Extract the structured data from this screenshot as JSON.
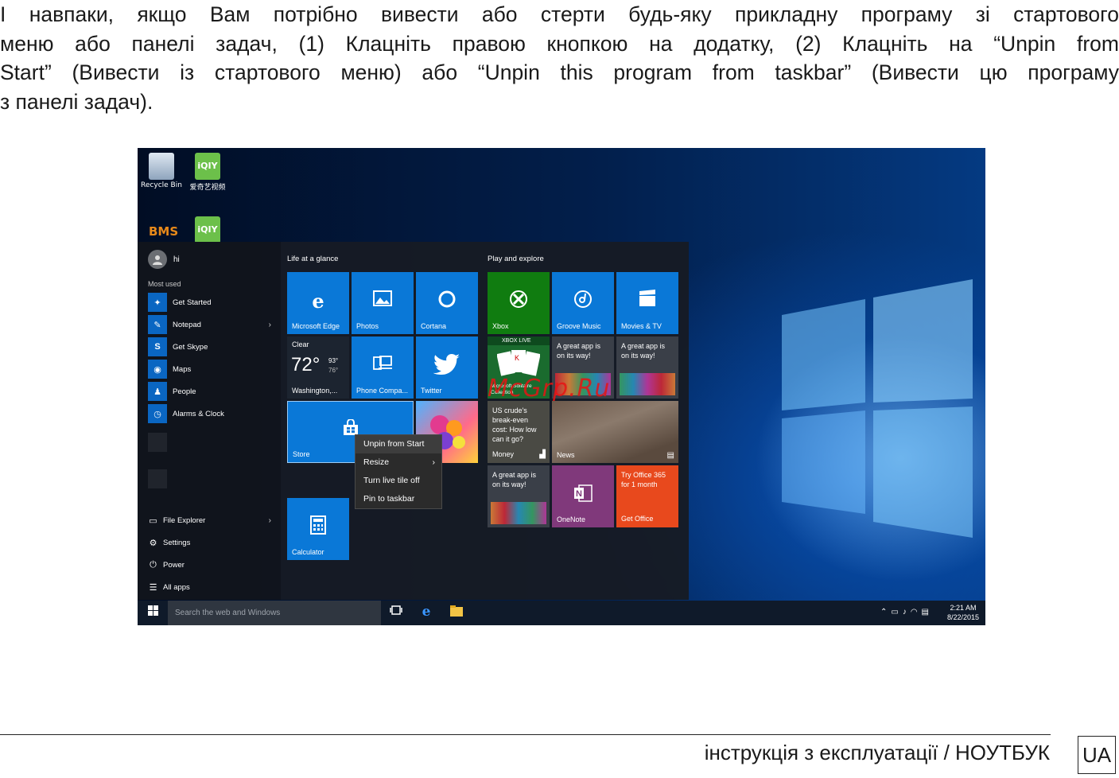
{
  "intro": {
    "line1": "І навпаки, якщо Вам потрібно вивести або стерти будь-яку прикладну програму зі стартового",
    "line2": "меню або панелі задач, (1) Клацніть правою кнопкою на додатку, (2) Клацніть на “Unpin from",
    "line3": "Start” (Вивести із стартового меню) або “Unpin this program from taskbar” (Вивести цю програму",
    "line4": "з панелі задач)."
  },
  "desktop": {
    "icons": [
      {
        "label": "Recycle Bin",
        "icon": "recycle-bin-icon"
      },
      {
        "label": "爱奇艺视频",
        "icon": "iqiyi-icon"
      }
    ]
  },
  "start_menu": {
    "user_name": "hi",
    "most_used_title": "Most used",
    "most_used": [
      {
        "label": "Get Started",
        "icon": "lightbulb-icon",
        "glyph": "💡"
      },
      {
        "label": "Notepad",
        "icon": "notepad-icon",
        "glyph": "✎"
      },
      {
        "label": "Get Skype",
        "icon": "skype-icon",
        "glyph": "S"
      },
      {
        "label": "Maps",
        "icon": "maps-icon",
        "glyph": "◉"
      },
      {
        "label": "People",
        "icon": "people-icon",
        "glyph": "👥"
      },
      {
        "label": "Alarms & Clock",
        "icon": "alarm-icon",
        "glyph": "⏰"
      }
    ],
    "bottom": [
      {
        "label": "File Explorer",
        "icon": "folder-icon",
        "glyph": "🗀"
      },
      {
        "label": "Settings",
        "icon": "gear-icon",
        "glyph": "⚙"
      },
      {
        "label": "Power",
        "icon": "power-icon",
        "glyph": "⏻"
      },
      {
        "label": "All apps",
        "icon": "list-icon",
        "glyph": "☰"
      }
    ],
    "group1_title": "Life at a glance",
    "group2_title": "Play and explore",
    "tiles": {
      "edge": "Microsoft Edge",
      "photos": "Photos",
      "cortana": "Cortana",
      "weather_cond": "Clear",
      "weather_temp": "72°",
      "weather_hi": "93°",
      "weather_lo": "76°",
      "weather_city": "Washington,...",
      "phone": "Phone Compa...",
      "twitter": "Twitter",
      "store": "Store",
      "calculator": "Calculator",
      "xbox": "Xbox",
      "groove": "Groove Music",
      "movies": "Movies & TV",
      "xbox_live": "XBOX LIVE",
      "solitaire": "Microsoft Solitaire Collection",
      "great_app_1": "A great app is on its way!",
      "great_app_2": "A great app is on its way!",
      "money_text": "US crude's break-even cost: How low can it go?",
      "money": "Money",
      "news": "News",
      "great_app_3": "A great app is on its way!",
      "onenote": "OneNote",
      "office_promo": "Try Office 365 for 1 month",
      "get_office": "Get Office"
    }
  },
  "context_menu": {
    "items": [
      "Unpin from Start",
      "Resize",
      "Turn live tile off",
      "Pin to taskbar"
    ]
  },
  "taskbar": {
    "search_placeholder": "Search the web and Windows",
    "time": "2:21 AM",
    "date": "8/22/2015"
  },
  "watermark": "McGrp.Ru",
  "footer": {
    "text": "інструкція з експлуатації / НОУТБУК",
    "lang": "UA"
  }
}
